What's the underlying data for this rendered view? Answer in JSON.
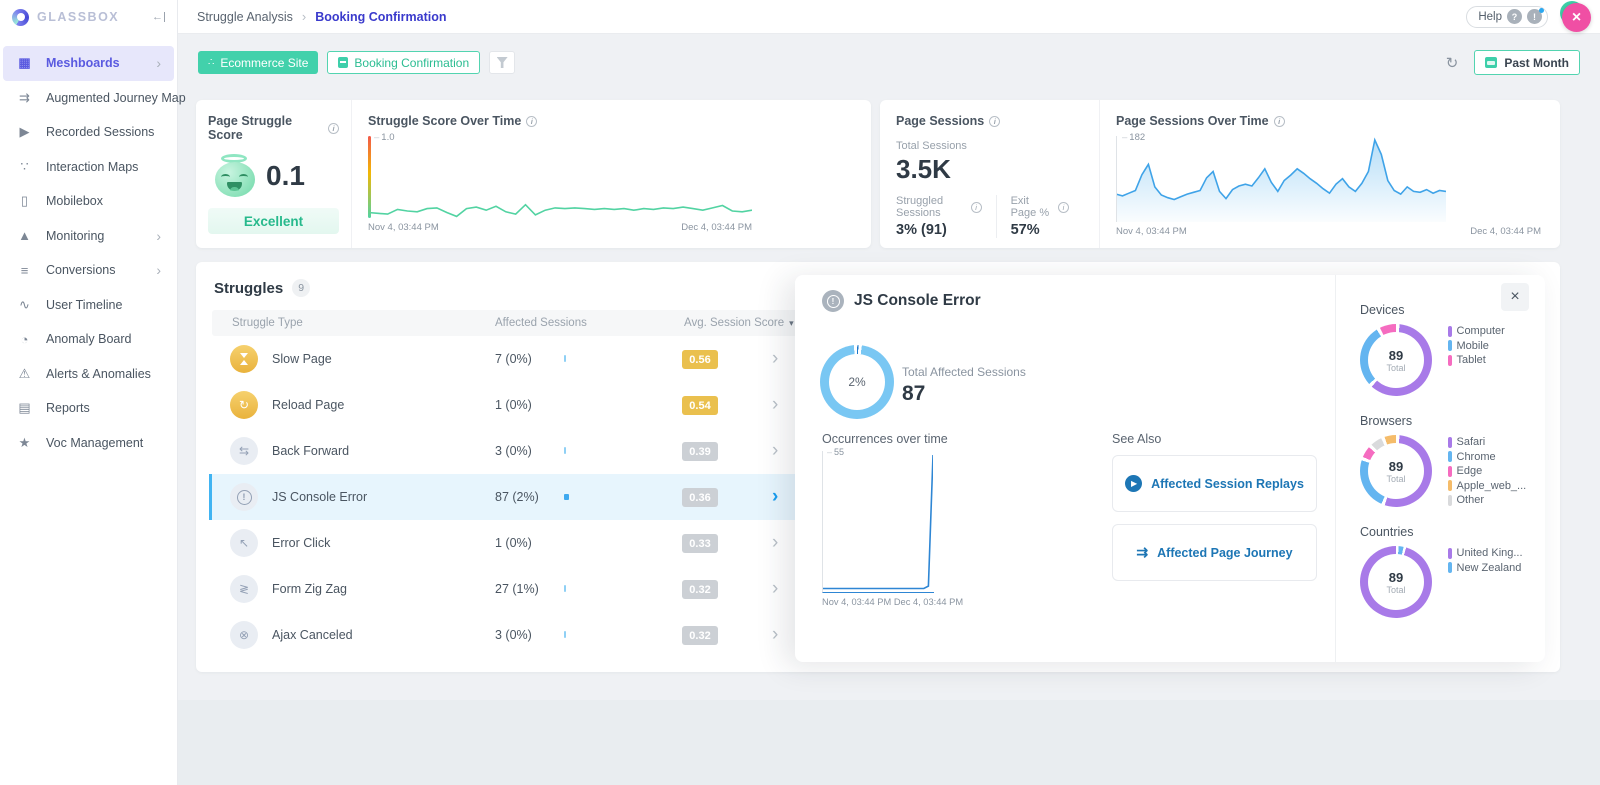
{
  "sidebar": {
    "logo_text": "GLASSBOX",
    "items": [
      {
        "label": "Meshboards",
        "icon": "meshboards",
        "active": true,
        "chevron": true
      },
      {
        "label": "Augmented Journey Map",
        "icon": "augmented-journey-map"
      },
      {
        "label": "Recorded Sessions",
        "icon": "recorded-sessions"
      },
      {
        "label": "Interaction Maps",
        "icon": "interaction-maps"
      },
      {
        "label": "Mobilebox",
        "icon": "mobilebox"
      },
      {
        "label": "Monitoring",
        "icon": "monitoring",
        "chevron": true
      },
      {
        "label": "Conversions",
        "icon": "conversions",
        "chevron": true
      },
      {
        "label": "User Timeline",
        "icon": "user-timeline"
      },
      {
        "label": "Anomaly Board",
        "icon": "anomaly-board"
      },
      {
        "label": "Alerts & Anomalies",
        "icon": "alerts-anomalies"
      },
      {
        "label": "Reports",
        "icon": "reports"
      },
      {
        "label": "Voc Management",
        "icon": "voc-management"
      }
    ]
  },
  "header": {
    "breadcrumb_parent": "Struggle Analysis",
    "breadcrumb_current": "Booking Confirmation",
    "help_label": "Help"
  },
  "filter_bar": {
    "site_chip": "Ecommerce Site",
    "page_chip": "Booking Confirmation",
    "date_range": "Past Month"
  },
  "score_card": {
    "title": "Page Struggle Score",
    "value": "0.1",
    "status": "Excellent"
  },
  "sessions_card": {
    "title": "Page Sessions",
    "total_label": "Total Sessions",
    "total": "3.5K",
    "struggled_label": "Struggled Sessions",
    "struggled": "3% (91)",
    "exit_label": "Exit Page %",
    "exit": "57%"
  },
  "struggles": {
    "title": "Struggles",
    "count": "9",
    "columns": [
      "Struggle Type",
      "Affected Sessions",
      "Avg. Session Score"
    ],
    "rows": [
      {
        "name": "Slow Page",
        "icon": "slow-page",
        "tone": "gold",
        "sessions": "7 (0%)",
        "spark": 1,
        "score": "0.56",
        "score_tone": "yellow"
      },
      {
        "name": "Reload Page",
        "icon": "reload-page",
        "tone": "gold",
        "sessions": "1 (0%)",
        "spark": 0,
        "score": "0.54",
        "score_tone": "yellow"
      },
      {
        "name": "Back Forward",
        "icon": "back-forward",
        "tone": "gray",
        "sessions": "3 (0%)",
        "spark": 1,
        "score": "0.39",
        "score_tone": "gray"
      },
      {
        "name": "JS Console Error",
        "icon": "js-console-error",
        "tone": "gray",
        "sessions": "87 (2%)",
        "spark": 2,
        "score": "0.36",
        "score_tone": "gray",
        "selected": true
      },
      {
        "name": "Error Click",
        "icon": "error-click",
        "tone": "gray",
        "sessions": "1 (0%)",
        "spark": 0,
        "score": "0.33",
        "score_tone": "gray"
      },
      {
        "name": "Form Zig Zag",
        "icon": "form-zig-zag",
        "tone": "gray",
        "sessions": "27 (1%)",
        "spark": 1,
        "score": "0.32",
        "score_tone": "gray"
      },
      {
        "name": "Ajax Canceled",
        "icon": "ajax-canceled",
        "tone": "gray",
        "sessions": "3 (0%)",
        "spark": 1,
        "score": "0.32",
        "score_tone": "gray"
      }
    ]
  },
  "detail_panel": {
    "title": "JS Console Error",
    "donut_center": "2%",
    "total_label": "Total Affected Sessions",
    "total_value": "87",
    "occurrences_label": "Occurrences over time",
    "see_also_label": "See Also",
    "links": [
      {
        "label": "Affected Session Replays",
        "icon": "session-replays"
      },
      {
        "label": "Affected Page Journey",
        "icon": "page-journey"
      }
    ],
    "stats": [
      {
        "heading": "Devices",
        "total": "89",
        "total_label": "Total",
        "donut": "devices_donut"
      },
      {
        "heading": "Browsers",
        "total": "89",
        "total_label": "Total",
        "donut": "browsers_donut"
      },
      {
        "heading": "Countries",
        "total": "89",
        "total_label": "Total",
        "donut": "countries_donut"
      }
    ]
  },
  "chart_data": [
    {
      "id": "struggle_score_over_time",
      "type": "line",
      "title": "Struggle Score Over Time",
      "color": "#52d3a2",
      "ylim": [
        0,
        1
      ],
      "y_top_label": "1.0",
      "x_labels": [
        "Nov 4, 03:44 PM",
        "Dec 4, 03:44 PM"
      ],
      "values": [
        0.07,
        0.06,
        0.05,
        0.11,
        0.09,
        0.08,
        0.12,
        0.13,
        0.07,
        0.02,
        0.12,
        0.14,
        0.1,
        0.15,
        0.08,
        0.05,
        0.17,
        0.04,
        0.1,
        0.13,
        0.12,
        0.13,
        0.12,
        0.11,
        0.12,
        0.11,
        0.12,
        0.1,
        0.12,
        0.11,
        0.13,
        0.12,
        0.14,
        0.12,
        0.1,
        0.13,
        0.16,
        0.09,
        0.08,
        0.1
      ]
    },
    {
      "id": "page_sessions_over_time",
      "type": "area",
      "title": "Page Sessions Over Time",
      "color": "#3fa3e8",
      "ylim": [
        0,
        182
      ],
      "y_top_label": "182",
      "x_labels": [
        "Nov 4, 03:44 PM",
        "Dec 4, 03:44 PM"
      ],
      "values": [
        62,
        58,
        64,
        70,
        105,
        128,
        78,
        60,
        54,
        50,
        56,
        62,
        66,
        70,
        98,
        112,
        68,
        52,
        72,
        80,
        84,
        80,
        98,
        118,
        88,
        68,
        92,
        104,
        118,
        108,
        96,
        86,
        74,
        64,
        84,
        96,
        78,
        68,
        86,
        112,
        182,
        150,
        92,
        70,
        62,
        78,
        68,
        66,
        72,
        64,
        70,
        68
      ]
    },
    {
      "id": "occurrences_over_time",
      "type": "line",
      "title": "Occurrences over time",
      "color": "#2e86d4",
      "ylim": [
        0,
        55
      ],
      "y_top_label": "55",
      "x_labels": [
        "Nov 4, 03:44 PM",
        "Dec 4, 03:44 PM"
      ],
      "values": [
        1,
        1,
        1,
        1,
        1,
        1,
        1,
        1,
        1,
        1,
        1,
        1,
        1,
        1,
        1,
        1,
        1,
        1,
        1,
        1,
        1,
        1,
        1,
        2,
        55
      ]
    },
    {
      "id": "affected_sessions_donut",
      "type": "pie",
      "center_label": "2%",
      "from_deg": -5,
      "gap": 1.5,
      "segments": [
        {
          "label": "Affected",
          "value": 2,
          "color": "#1b76c9"
        },
        {
          "label": "Remaining",
          "value": 98,
          "color": "#79c7f3"
        }
      ],
      "order": [
        0,
        1
      ]
    },
    {
      "id": "devices_donut",
      "type": "pie",
      "total": 89,
      "gap": 1.6,
      "segments": [
        {
          "label": "Computer",
          "value": 55,
          "color": "#a87ae8"
        },
        {
          "label": "Mobile",
          "value": 26,
          "color": "#64b5f0"
        },
        {
          "label": "Tablet",
          "value": 8,
          "color": "#f56cc0"
        }
      ],
      "order": [
        0,
        1,
        2
      ]
    },
    {
      "id": "browsers_donut",
      "type": "pie",
      "total": 89,
      "gap": 1.6,
      "segments": [
        {
          "label": "Safari",
          "value": 49,
          "color": "#a87ae8"
        },
        {
          "label": "Chrome",
          "value": 22,
          "color": "#64b5f0"
        },
        {
          "label": "Edge",
          "value": 6,
          "color": "#f56cc0"
        },
        {
          "label": "Apple_web_...",
          "value": 6,
          "color": "#f5bc6a"
        },
        {
          "label": "Other",
          "value": 6,
          "color": "#d9dadc"
        }
      ],
      "order": [
        0,
        1,
        2,
        4,
        3
      ]
    },
    {
      "id": "countries_donut",
      "type": "pie",
      "total": 89,
      "gap": 1.2,
      "segments": [
        {
          "label": "United King...",
          "value": 86,
          "color": "#a87ae8"
        },
        {
          "label": "New Zealand",
          "value": 3,
          "color": "#64b5f0"
        }
      ],
      "order": [
        1,
        0
      ]
    }
  ],
  "colors": {
    "accent_teal": "#3ecfaa",
    "accent_purple": "#5a5ae0",
    "breadcrumb_active": "#3a3acc",
    "selected_row_blue": "#41b4f2",
    "score_yellow": "#eac04e",
    "score_gray": "#ccd0d5",
    "link_blue": "#1d76b5",
    "pink_close": "#f04fa4"
  }
}
